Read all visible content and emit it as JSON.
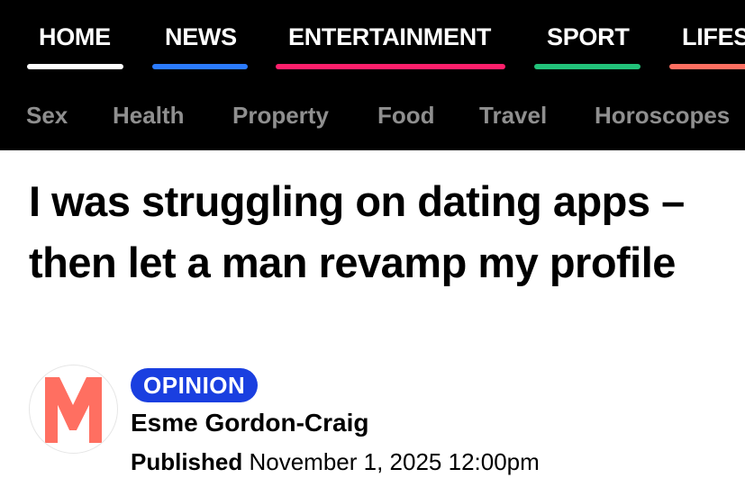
{
  "nav": {
    "primary": [
      {
        "label": "HOME",
        "color": "#ffffff"
      },
      {
        "label": "NEWS",
        "color": "#2b7bff"
      },
      {
        "label": "ENTERTAINMENT",
        "color": "#ff1f6b"
      },
      {
        "label": "SPORT",
        "color": "#22c27a"
      },
      {
        "label": "LIFESTYLE",
        "color": "#ff6f61"
      }
    ],
    "secondary": [
      "Sex",
      "Health",
      "Property",
      "Food",
      "Travel",
      "Horoscopes"
    ]
  },
  "article": {
    "headline": "I was struggling on dating apps – then let a man revamp my profile",
    "category_badge": "OPINION",
    "author": "Esme Gordon-Craig",
    "published_label": "Published",
    "published_date": "November 1, 2025 12:00pm"
  },
  "colors": {
    "badge": "#1a3fe0",
    "avatar_logo": "#ff6f61"
  },
  "icons": {
    "avatar": "masthead-m-logo"
  }
}
